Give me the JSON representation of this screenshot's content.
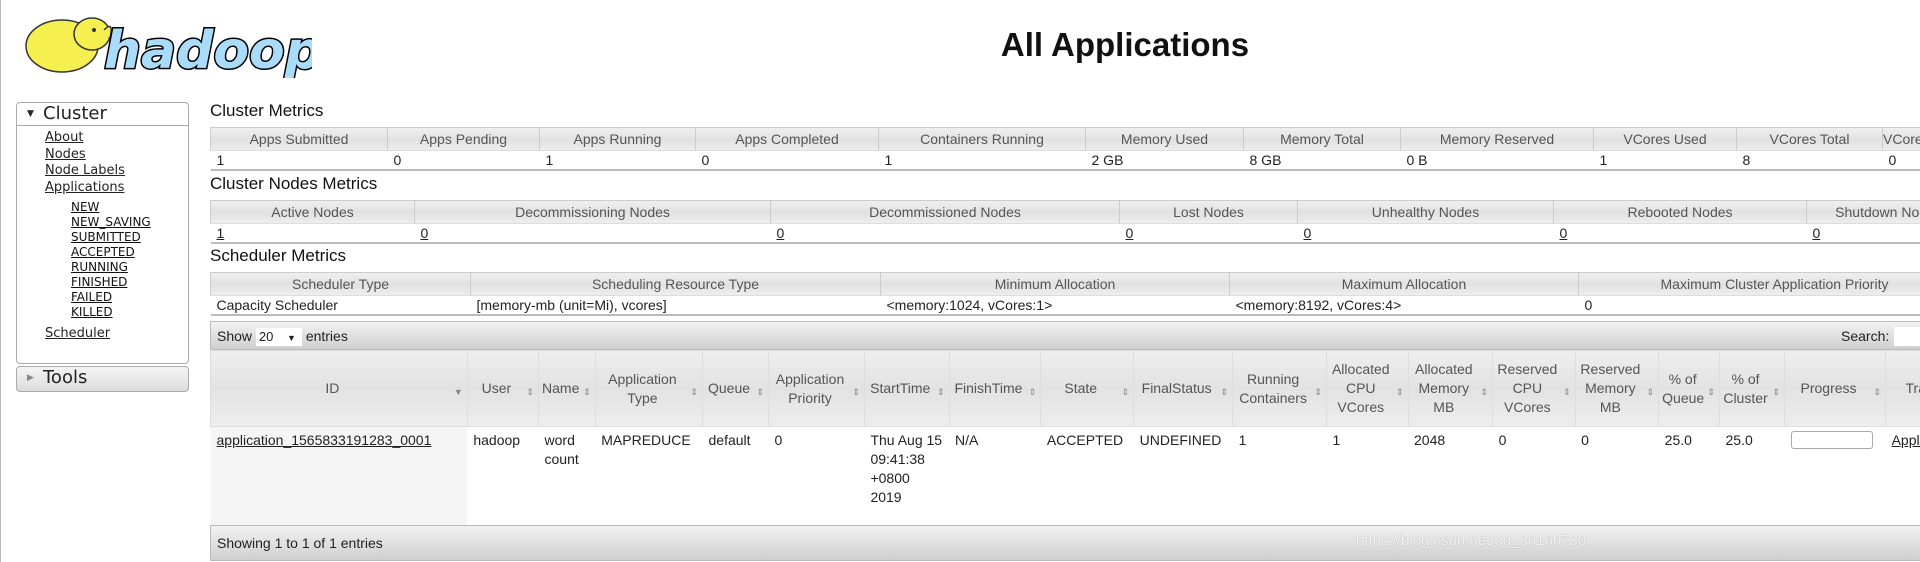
{
  "logo": {
    "text": "hadoop",
    "colors": {
      "elephant": "#f5f050",
      "text": "#a8dcfa"
    }
  },
  "title": "All Applications",
  "nav": {
    "cluster": {
      "label": "Cluster",
      "links": [
        "About",
        "Nodes",
        "Node Labels",
        "Applications"
      ],
      "states": [
        "NEW",
        "NEW_SAVING",
        "SUBMITTED",
        "ACCEPTED",
        "RUNNING",
        "FINISHED",
        "FAILED",
        "KILLED"
      ],
      "scheduler": "Scheduler"
    },
    "tools": {
      "label": "Tools"
    }
  },
  "cluster_metrics": {
    "title": "Cluster Metrics",
    "headers": [
      "Apps Submitted",
      "Apps Pending",
      "Apps Running",
      "Apps Completed",
      "Containers Running",
      "Memory Used",
      "Memory Total",
      "Memory Reserved",
      "VCores Used",
      "VCores Total",
      "VCores Reserved"
    ],
    "values": [
      "1",
      "0",
      "1",
      "0",
      "1",
      "2 GB",
      "8 GB",
      "0 B",
      "1",
      "8",
      "0"
    ]
  },
  "nodes_metrics": {
    "title": "Cluster Nodes Metrics",
    "headers": [
      "Active Nodes",
      "Decommissioning Nodes",
      "Decommissioned Nodes",
      "Lost Nodes",
      "Unhealthy Nodes",
      "Rebooted Nodes",
      "Shutdown Nodes"
    ],
    "values": [
      "1",
      "0",
      "0",
      "0",
      "0",
      "0",
      "0"
    ]
  },
  "scheduler_metrics": {
    "title": "Scheduler Metrics",
    "headers": [
      "Scheduler Type",
      "Scheduling Resource Type",
      "Minimum Allocation",
      "Maximum Allocation",
      "Maximum Cluster Application Priority"
    ],
    "values": [
      "Capacity Scheduler",
      "[memory-mb (unit=Mi), vcores]",
      "<memory:1024, vCores:1>",
      "<memory:8192, vCores:4>",
      "0"
    ]
  },
  "apps": {
    "show_label": "Show",
    "entries_value": "20",
    "entries_label": "entries",
    "search_label": "Search:",
    "search_value": "",
    "headers": [
      "ID",
      "User",
      "Name",
      "Application Type",
      "Queue",
      "Application Priority",
      "StartTime",
      "FinishTime",
      "State",
      "FinalStatus",
      "Running Containers",
      "Allocated CPU VCores",
      "Allocated Memory MB",
      "Reserved CPU VCores",
      "Reserved Memory MB",
      "% of Queue",
      "% of Cluster",
      "Progress",
      "Tracking UI"
    ],
    "rows": [
      {
        "id": "application_1565833191283_0001",
        "user": "hadoop",
        "name": "word count",
        "type": "MAPREDUCE",
        "queue": "default",
        "priority": "0",
        "start": "Thu Aug 15 09:41:38 +0800 2019",
        "finish": "N/A",
        "state": "ACCEPTED",
        "final": "UNDEFINED",
        "running": "1",
        "alloc_cpu": "1",
        "alloc_mem": "2048",
        "res_cpu": "0",
        "res_mem": "0",
        "pct_queue": "25.0",
        "pct_cluster": "25.0",
        "progress": 0,
        "tracking": "ApplicationMaster"
      }
    ],
    "footer": "Showing 1 to 1 of 1 entries"
  },
  "watermark": "https://blog.csdn.net/qq_36160730"
}
